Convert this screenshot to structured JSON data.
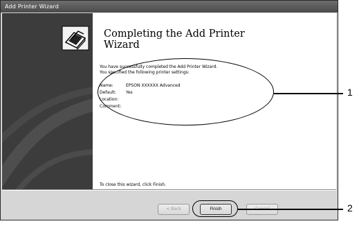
{
  "window": {
    "title": "Add Printer Wizard"
  },
  "content": {
    "heading_line1": "Completing the Add Printer",
    "heading_line2": "Wizard",
    "intro_line1": "You have successfully completed the Add Printer Wizard.",
    "intro_line2": "You specified the following printer settings:",
    "settings": [
      {
        "label": "Name:",
        "value": "EPSON XXXXXX Advanced"
      },
      {
        "label": "Default:",
        "value": "Yes"
      },
      {
        "label": "Location:",
        "value": ""
      },
      {
        "label": "Comment:",
        "value": ""
      }
    ],
    "footer": "To close this wizard, click Finish."
  },
  "buttons": {
    "back": "< Back",
    "finish": "Finish",
    "cancel": "Cancel"
  },
  "callouts": {
    "one": "1",
    "two": "2"
  }
}
